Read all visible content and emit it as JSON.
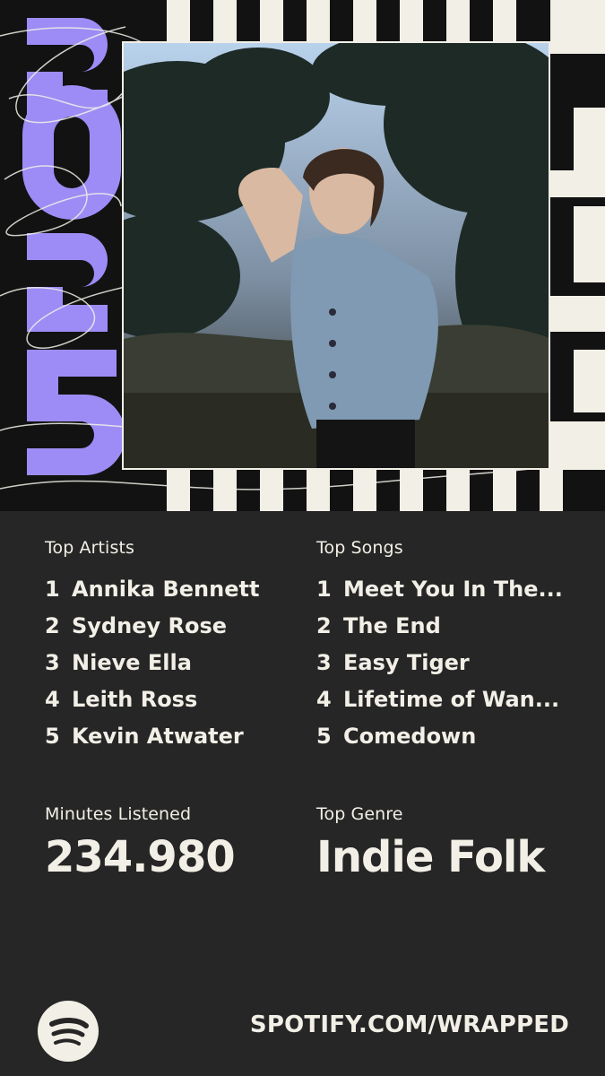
{
  "header": {
    "year_art": "2025"
  },
  "top_artists": {
    "label": "Top Artists",
    "items": [
      {
        "rank": "1",
        "name": "Annika Bennett"
      },
      {
        "rank": "2",
        "name": "Sydney Rose"
      },
      {
        "rank": "3",
        "name": "Nieve Ella"
      },
      {
        "rank": "4",
        "name": "Leith Ross"
      },
      {
        "rank": "5",
        "name": "Kevin Atwater"
      }
    ]
  },
  "top_songs": {
    "label": "Top Songs",
    "items": [
      {
        "rank": "1",
        "name": "Meet You In The..."
      },
      {
        "rank": "2",
        "name": "The End"
      },
      {
        "rank": "3",
        "name": "Easy Tiger"
      },
      {
        "rank": "4",
        "name": "Lifetime of Wan..."
      },
      {
        "rank": "5",
        "name": "Comedown"
      }
    ]
  },
  "minutes": {
    "label": "Minutes Listened",
    "value": "234.980"
  },
  "genre": {
    "label": "Top Genre",
    "value": "Indie Folk"
  },
  "footer": {
    "url": "SPOTIFY.COM/WRAPPED",
    "logo_icon": "spotify-logo-icon"
  },
  "colors": {
    "background": "#262626",
    "text": "#f2efe7",
    "accent_purple": "#9d8cf5",
    "stripe_dark": "#121212"
  }
}
